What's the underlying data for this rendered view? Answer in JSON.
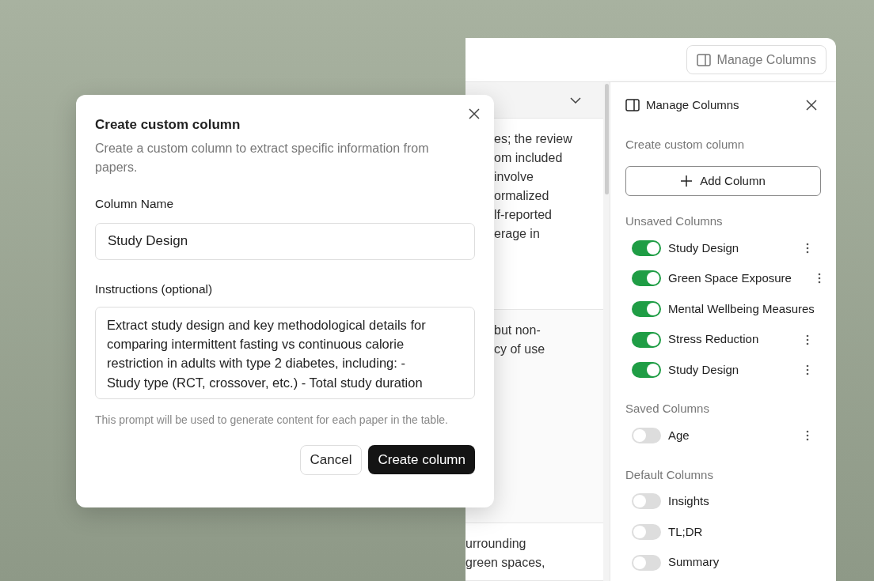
{
  "app": {
    "header_button": "Manage Columns",
    "table": {
      "rows": [
        {
          "text": "es; the review\nom included\ninvolve\normalized\nlf-reported\nerage in"
        },
        {
          "text": "but non-\ncy of use"
        },
        {
          "text": "urrounding\ngreen spaces,"
        }
      ]
    },
    "panel": {
      "title": "Manage Columns",
      "create_label": "Create custom column",
      "add_button": "Add Column",
      "sections": [
        {
          "title": "Unsaved Columns",
          "columns": [
            {
              "name": "Study Design",
              "on": true,
              "menu": true
            },
            {
              "name": "Green Space Exposure",
              "on": true,
              "menu": true
            },
            {
              "name": "Mental Wellbeing Measures",
              "on": true,
              "menu": false
            },
            {
              "name": "Stress Reduction",
              "on": true,
              "menu": true
            },
            {
              "name": "Study Design",
              "on": true,
              "menu": true
            }
          ]
        },
        {
          "title": "Saved Columns",
          "columns": [
            {
              "name": "Age",
              "on": false,
              "menu": true
            }
          ]
        },
        {
          "title": "Default Columns",
          "columns": [
            {
              "name": "Insights",
              "on": false,
              "menu": false
            },
            {
              "name": "TL;DR",
              "on": false,
              "menu": false
            },
            {
              "name": "Summary",
              "on": false,
              "menu": false
            }
          ]
        }
      ]
    }
  },
  "dialog": {
    "title": "Create custom column",
    "description": "Create a custom column to extract specific information from papers.",
    "column_name": {
      "label": "Column Name",
      "value": "Study Design"
    },
    "instructions": {
      "label": "Instructions (optional)",
      "lines": [
        "Extract study design and key methodological details for",
        "comparing intermittent fasting vs continuous calorie",
        "restriction in adults with type 2 diabetes, including: -",
        "Study type (RCT, crossover, etc.) - Total study duration"
      ]
    },
    "hint": "This prompt will be used to generate content for each paper in the table.",
    "buttons": [
      {
        "label": "Cancel",
        "kind": "secondary"
      },
      {
        "label": "Create column",
        "kind": "primary"
      }
    ]
  }
}
